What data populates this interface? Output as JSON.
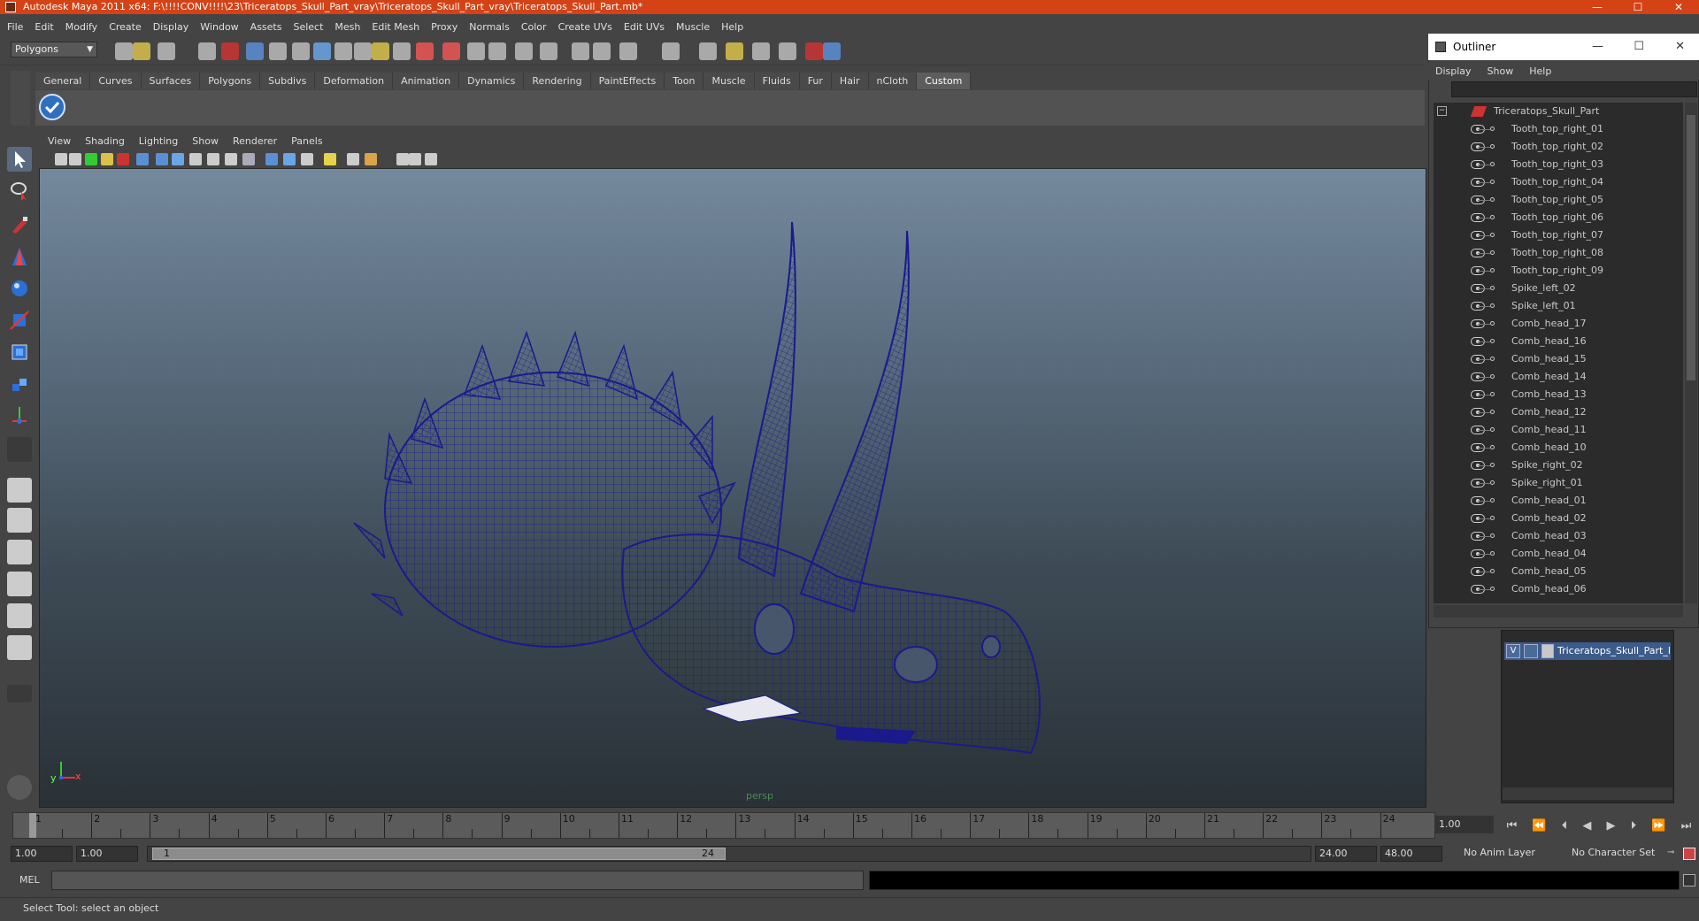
{
  "window": {
    "title": "Autodesk Maya 2011 x64: F:\\!!!!CONV!!!!\\23\\Triceratops_Skull_Part_vray\\Triceratops_Skull_Part_vray\\Triceratops_Skull_Part.mb*",
    "minimize": "—",
    "maximize": "☐",
    "close": "✕"
  },
  "menubar": [
    "File",
    "Edit",
    "Modify",
    "Create",
    "Display",
    "Window",
    "Assets",
    "Select",
    "Mesh",
    "Edit Mesh",
    "Proxy",
    "Normals",
    "Color",
    "Create UVs",
    "Edit UVs",
    "Muscle",
    "Help"
  ],
  "status": {
    "mode": "Polygons"
  },
  "shelf": {
    "tabs": [
      "General",
      "Curves",
      "Surfaces",
      "Polygons",
      "Subdivs",
      "Deformation",
      "Animation",
      "Dynamics",
      "Rendering",
      "PaintEffects",
      "Toon",
      "Muscle",
      "Fluids",
      "Fur",
      "Hair",
      "nCloth",
      "Custom"
    ],
    "active_tab": "Custom"
  },
  "panel": {
    "menus": [
      "View",
      "Shading",
      "Lighting",
      "Show",
      "Renderer",
      "Panels"
    ],
    "camera_label": "persp",
    "axis_y": "y",
    "axis_x": "x"
  },
  "outliner": {
    "title": "Outliner",
    "menus": [
      "Display",
      "Show",
      "Help"
    ],
    "root": "Triceratops_Skull_Part",
    "items": [
      "Tooth_top_right_01",
      "Tooth_top_right_02",
      "Tooth_top_right_03",
      "Tooth_top_right_04",
      "Tooth_top_right_05",
      "Tooth_top_right_06",
      "Tooth_top_right_07",
      "Tooth_top_right_08",
      "Tooth_top_right_09",
      "Spike_left_02",
      "Spike_left_01",
      "Comb_head_17",
      "Comb_head_16",
      "Comb_head_15",
      "Comb_head_14",
      "Comb_head_13",
      "Comb_head_12",
      "Comb_head_11",
      "Comb_head_10",
      "Spike_right_02",
      "Spike_right_01",
      "Comb_head_01",
      "Comb_head_02",
      "Comb_head_03",
      "Comb_head_04",
      "Comb_head_05",
      "Comb_head_06"
    ]
  },
  "layers": {
    "visible_flag": "V",
    "layer_name": "Triceratops_Skull_Part_la"
  },
  "timeline": {
    "ticks": [
      "1",
      "2",
      "3",
      "4",
      "5",
      "6",
      "7",
      "8",
      "9",
      "10",
      "11",
      "12",
      "13",
      "14",
      "15",
      "16",
      "17",
      "18",
      "19",
      "20",
      "21",
      "22",
      "23",
      "24"
    ],
    "current_frame": "1.00",
    "start_time": "1.00",
    "playback_start": "1.00",
    "range_start": "1",
    "range_end": "24",
    "playback_end": "24.00",
    "end_time": "48.00",
    "anim_layer": "No Anim Layer",
    "character_set": "No Character Set"
  },
  "command": {
    "label": "MEL"
  },
  "help": {
    "text": "Select Tool: select an object"
  },
  "colors": {
    "titlebar": "#d44216",
    "wireframe": "#1a1a8c",
    "selection": "#3c5b8a"
  }
}
